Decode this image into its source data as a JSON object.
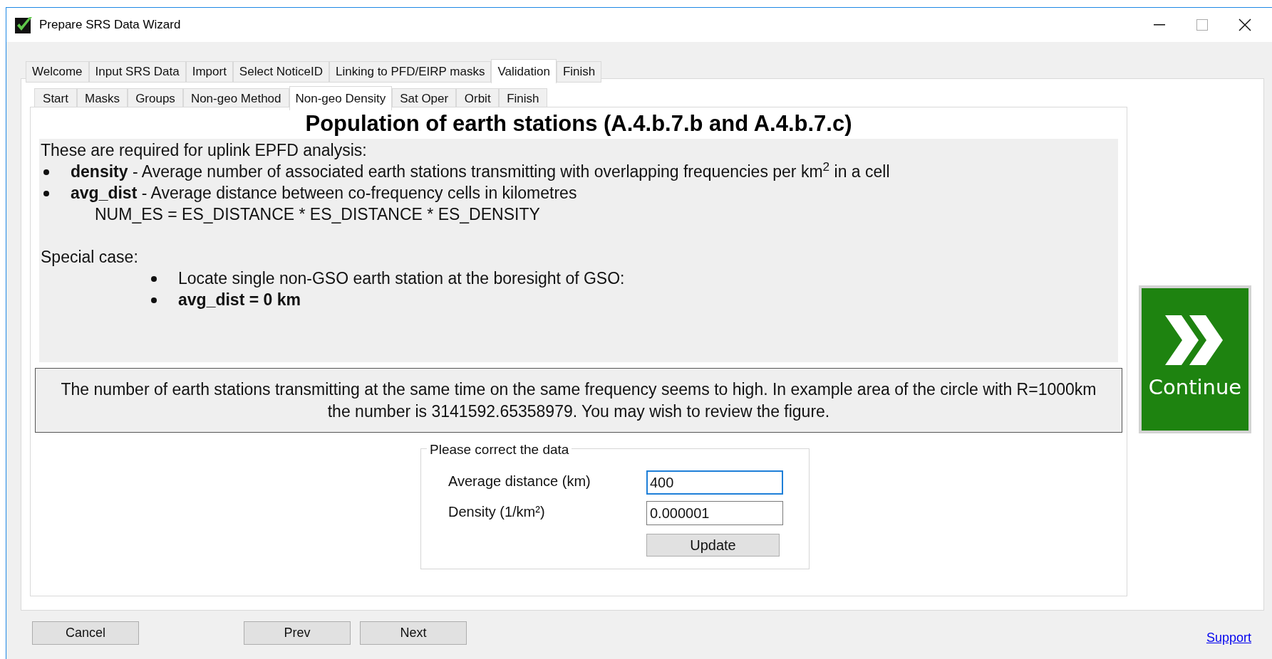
{
  "window": {
    "title": "Prepare SRS Data Wizard"
  },
  "outer_tabs": [
    {
      "label": "Welcome",
      "selected": false
    },
    {
      "label": "Input SRS Data",
      "selected": false
    },
    {
      "label": "Import",
      "selected": false
    },
    {
      "label": "Select NoticeID",
      "selected": false
    },
    {
      "label": "Linking to PFD/EIRP masks",
      "selected": false
    },
    {
      "label": "Validation",
      "selected": true
    },
    {
      "label": "Finish",
      "selected": false
    }
  ],
  "inner_tabs": [
    {
      "label": "Start",
      "selected": false
    },
    {
      "label": "Masks",
      "selected": false
    },
    {
      "label": "Groups",
      "selected": false
    },
    {
      "label": "Non-geo Method",
      "selected": false
    },
    {
      "label": "Non-geo Density",
      "selected": true
    },
    {
      "label": "Sat Oper",
      "selected": false
    },
    {
      "label": "Orbit",
      "selected": false
    },
    {
      "label": "Finish",
      "selected": false
    }
  ],
  "heading": "Population of earth stations (A.4.b.7.b and A.4.b.7.c)",
  "info": {
    "intro": "These are required for uplink EPFD analysis:",
    "bullets": [
      "**density** - Average number of associated earth stations transmitting with overlapping frequencies per km$^{2}$ in a cell",
      "**avg_dist** - Average distance between co-frequency cells in kilometres"
    ],
    "formula": "NUM_ES = ES_DISTANCE * ES_DISTANCE * ES_DENSITY",
    "special_label": "Special case:",
    "special_bullets": [
      {
        "text": "Locate single non-GSO earth station at the boresight of GSO:",
        "bold": false
      },
      {
        "text": "avg_dist = 0 km",
        "bold": true
      }
    ]
  },
  "warning": "The number of earth stations transmitting at the same time on the same frequency seems to high. In example area of the circle with R=1000km the number is 3141592.65358979. You may wish to review the figure.",
  "correction": {
    "legend": "Please correct the data",
    "fields": [
      {
        "label": "Average distance (km)",
        "value": "400",
        "focused": true
      },
      {
        "label": "Density (1/km²)",
        "value": "0.000001",
        "focused": false
      }
    ],
    "button": "Update"
  },
  "continue_button": "Continue",
  "footer": {
    "buttons": [
      "Cancel",
      "Prev",
      "Next"
    ],
    "link": "Support"
  }
}
